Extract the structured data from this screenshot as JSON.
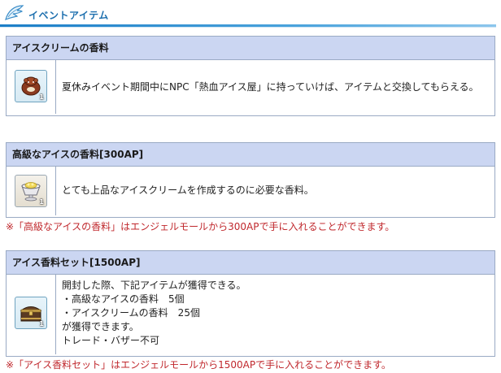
{
  "section": {
    "title": "イベントアイテム",
    "icon": "wing-icon"
  },
  "items": [
    {
      "name": "アイスクリームの香料",
      "icon": "ice-cream-flavor-icon",
      "count": "1",
      "description": "夏休みイベント期間中にNPC「熱血アイス屋」に持っていけば、アイテムと交換してもらえる。"
    },
    {
      "name": "高級なアイスの香料[300AP]",
      "icon": "premium-flavor-cup-icon",
      "count": "1",
      "description": "とても上品なアイスクリームを作成するのに必要な香料。",
      "note": "※「高級なアイスの香料」はエンジェルモールから300APで手に入れることができます。"
    },
    {
      "name": "アイス香料セット[1500AP]",
      "icon": "treasure-chest-icon",
      "count": "1",
      "description_lines": [
        "開封した際、下記アイテムが獲得できる。",
        "・高級なアイスの香料　5個",
        "・アイスクリームの香料　25個",
        "が獲得できます。",
        "トレード・バザー不可"
      ],
      "note": "※「アイス香料セット」はエンジェルモールから1500APで手に入れることができます。"
    }
  ],
  "colors": {
    "header_text": "#1d6fae",
    "table_head_bg": "#cbd6f2",
    "border": "#9aaac4",
    "note_text": "#c0282d"
  }
}
